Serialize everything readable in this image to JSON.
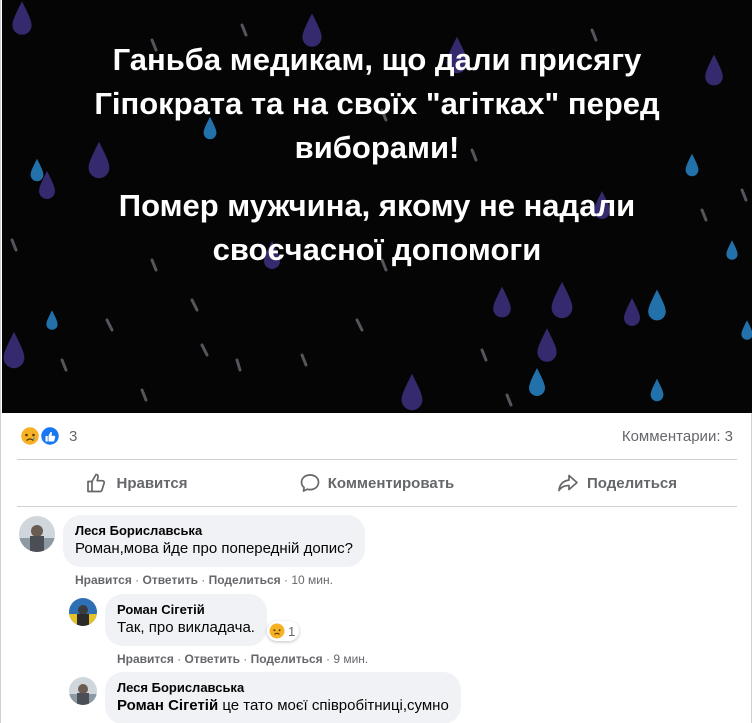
{
  "banner": {
    "line1": "Ганьба медикам, що дали присягу Гіпократа та на своїх \"агітках\" перед виборами!",
    "line2": "Помер мужчина, якому не надали своєчасної допомоги",
    "bg_color": "#050505",
    "drop_colors": [
      "#3a2f7a",
      "#2a86c9",
      "#5a4aa8",
      "#9aa0a6"
    ]
  },
  "stats": {
    "reaction_icons": [
      "sad-reaction-icon",
      "like-reaction-icon"
    ],
    "reaction_count": "3",
    "comments_count": "Комментарии: 3"
  },
  "actions": {
    "like": "Нравится",
    "comment": "Комментировать",
    "share": "Поделиться"
  },
  "comments": [
    {
      "author": "Леся Бориславська",
      "text": "Роман,мова йде про попередній допис?",
      "like": "Нравится",
      "reply": "Ответить",
      "share": "Поделиться",
      "time": "10 мин."
    },
    {
      "author": "Роман Сігетій",
      "text": "Так, про викладача.",
      "reaction_count": "1",
      "like": "Нравится",
      "reply": "Ответить",
      "share": "Поделиться",
      "time": "9 мин."
    },
    {
      "author": "Леся Бориславська",
      "mention": "Роман Сігетій",
      "text": " це тато моєї співробітниці,сумно"
    }
  ],
  "meta_separator": " · ",
  "colors": {
    "secondary_text": "#65676b",
    "bubble": "#f0f2f5",
    "like_blue": "#1877f2",
    "sad_yellow": "#f7b125"
  }
}
